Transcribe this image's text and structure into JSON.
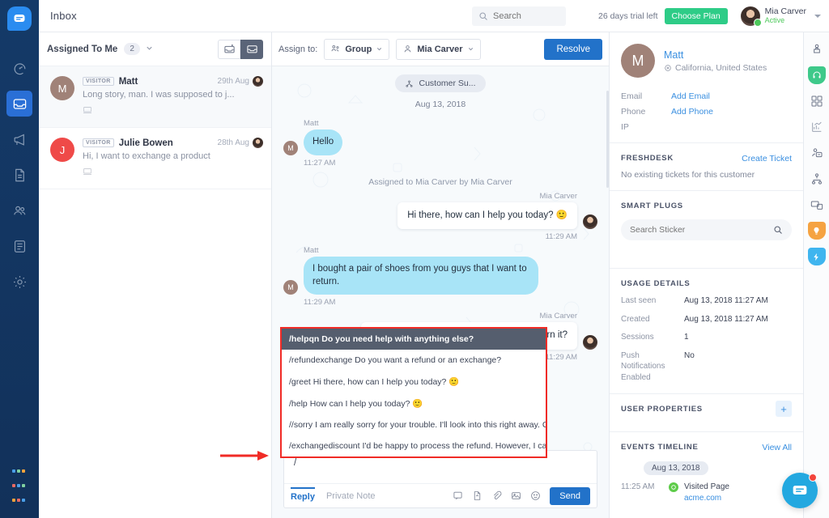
{
  "app": {
    "brand_color": "#2a8cf0",
    "nav_bg": "#14375f",
    "accent_blue": "#2272c9",
    "green": "#2ecc87",
    "highlight_row_bg": "#555e6e",
    "annotation_red": "#f02b26"
  },
  "nav": {
    "logo_icon": "chat-logo-icon",
    "items": [
      {
        "name": "dashboard",
        "icon": "speedometer-icon",
        "active": false
      },
      {
        "name": "inbox",
        "icon": "inbox-tray-icon",
        "active": true
      },
      {
        "name": "campaigns",
        "icon": "megaphone-icon",
        "active": false
      },
      {
        "name": "articles",
        "icon": "document-icon",
        "active": false
      },
      {
        "name": "contacts",
        "icon": "people-icon",
        "active": false
      },
      {
        "name": "reports",
        "icon": "clipboard-icon",
        "active": false
      },
      {
        "name": "settings",
        "icon": "gear-icon",
        "active": false
      }
    ],
    "apps_grid_icon": "apps-grid-icon"
  },
  "header": {
    "title": "Inbox",
    "search": {
      "placeholder": "Search",
      "value": "",
      "icon": "search-icon"
    },
    "trial_text": "26 days trial left",
    "plan_button": "Choose Plan",
    "user": {
      "name": "Mia Carver",
      "status": "Active",
      "avatar": "user-avatar",
      "caret": "chevron-down-icon"
    }
  },
  "conversation_list": {
    "header": {
      "title": "Assigned To Me",
      "count": "2",
      "chevron": "chevron-down-icon",
      "toggle_open_icon": "inbox-open-icon",
      "toggle_closed_icon": "inbox-archive-icon"
    },
    "items": [
      {
        "badge": "VISITOR",
        "name": "Matt",
        "snippet": "Long story, man. I was supposed to j...",
        "time": "29th Aug",
        "avatar_letter": "M",
        "avatar_color": "#a08278",
        "channel_icon": "web-chat-icon",
        "selected": true
      },
      {
        "badge": "VISITOR",
        "name": "Julie Bowen",
        "snippet": "Hi, I want to exchange a product",
        "time": "28th Aug",
        "avatar_letter": "J",
        "avatar_color": "#ef4a48",
        "channel_icon": "web-chat-icon",
        "selected": false
      }
    ]
  },
  "chat": {
    "assign_bar": {
      "label": "Assign to:",
      "group": {
        "value": "Group",
        "icon": "group-icon",
        "caret": "chevron-down-icon"
      },
      "agent": {
        "value": "Mia Carver",
        "icon": "agent-icon",
        "caret": "chevron-down-icon"
      },
      "resolve_button": "Resolve"
    },
    "tag_pill": {
      "label": "Customer Su...",
      "icon": "tag-node-icon"
    },
    "date_label": "Aug 13, 2018",
    "messages": [
      {
        "type": "incoming",
        "sender": "Matt",
        "text": "Hello",
        "time": "11:27 AM",
        "avatar_letter": "M"
      },
      {
        "type": "system",
        "text": "Assigned to Mia Carver by Mia Carver"
      },
      {
        "type": "outgoing",
        "sender": "Mia Carver",
        "text": "Hi there, how can I help you today? 🙂",
        "time": "11:29 AM"
      },
      {
        "type": "incoming",
        "sender": "Matt",
        "text": "I bought a pair of shoes from you guys that I want to return.",
        "time": "11:29 AM",
        "avatar_letter": "M"
      },
      {
        "type": "outgoing",
        "sender": "Mia Carver",
        "text": "May I know the reason you're trying to return it?",
        "time": "11:29 AM"
      }
    ],
    "autocomplete": {
      "visible": true,
      "items": [
        {
          "shortcut": "/helpqn",
          "text": "Do you need help with anything else?",
          "highlighted": true
        },
        {
          "shortcut": "/refundexchange",
          "text": "Do you want a refund or an exchange?",
          "highlighted": false
        },
        {
          "shortcut": "/greet",
          "text": "Hi there, how can I help you today? 🙂",
          "highlighted": false
        },
        {
          "shortcut": "/help",
          "text": "How can I help you today? 🙂",
          "highlighted": false
        },
        {
          "shortcut": "//sorry",
          "text": "I am really sorry for your trouble. I'll look into this right away. Could y",
          "highlighted": false
        },
        {
          "shortcut": "/exchangediscount",
          "text": "I'd be happy to process the refund. However, I can offer",
          "highlighted": false
        }
      ]
    },
    "composer": {
      "value": "/",
      "tab_reply": "Reply",
      "tab_note": "Private Note",
      "send_button": "Send",
      "icons": [
        "canned-response-icon",
        "article-icon",
        "attachment-icon",
        "image-icon",
        "emoji-icon"
      ]
    }
  },
  "right_panel": {
    "profile": {
      "avatar_letter": "M",
      "name": "Matt",
      "location": "California, United States",
      "location_icon": "location-pin-icon"
    },
    "fields": [
      {
        "key": "Email",
        "value": "Add Email",
        "is_link": true
      },
      {
        "key": "Phone",
        "value": "Add Phone",
        "is_link": true
      },
      {
        "key": "IP",
        "value": "",
        "is_link": false
      }
    ],
    "freshdesk": {
      "title": "FRESHDESK",
      "link": "Create Ticket",
      "note": "No existing tickets for this customer"
    },
    "smart_plugs": {
      "title": "SMART PLUGS",
      "search_placeholder": "Search Sticker",
      "search_icon": "search-icon"
    },
    "usage_details": {
      "title": "USAGE DETAILS",
      "rows": [
        {
          "key": "Last seen",
          "value": "Aug 13, 2018 11:27 AM"
        },
        {
          "key": "Created",
          "value": "Aug 13, 2018 11:27 AM"
        },
        {
          "key": "Sessions",
          "value": "1"
        },
        {
          "key": "Push Notifications Enabled",
          "value": "No"
        }
      ]
    },
    "user_properties": {
      "title": "USER PROPERTIES",
      "add_icon": "plus-icon"
    },
    "events_timeline": {
      "title": "EVENTS TIMELINE",
      "link": "View All",
      "date": "Aug 13, 2018",
      "events": [
        {
          "time": "11:25 AM",
          "title": "Visited Page",
          "url": "acme.com",
          "dot_icon": "page-visit-icon"
        }
      ]
    }
  },
  "app_rail": {
    "items": [
      {
        "name": "crm-app",
        "icon": "desk-person-icon",
        "tint": "none"
      },
      {
        "name": "support-app",
        "icon": "headset-icon",
        "tint": "#3ec98a"
      },
      {
        "name": "modules-app",
        "icon": "modules-icon",
        "tint": "none"
      },
      {
        "name": "analytics-app",
        "icon": "chart-up-icon",
        "tint": "none"
      },
      {
        "name": "deals-app",
        "icon": "handshake-icon",
        "tint": "none"
      },
      {
        "name": "org-app",
        "icon": "org-chart-icon",
        "tint": "none"
      },
      {
        "name": "devices-app",
        "icon": "devices-icon",
        "tint": "none"
      },
      {
        "name": "marketing-app",
        "icon": "bulb-icon",
        "tint": "#f5a342"
      },
      {
        "name": "automation-app",
        "icon": "bolt-icon",
        "tint": "#3fb5ef"
      }
    ]
  },
  "fab": {
    "icon": "chat-bubble-icon",
    "badge": true
  }
}
